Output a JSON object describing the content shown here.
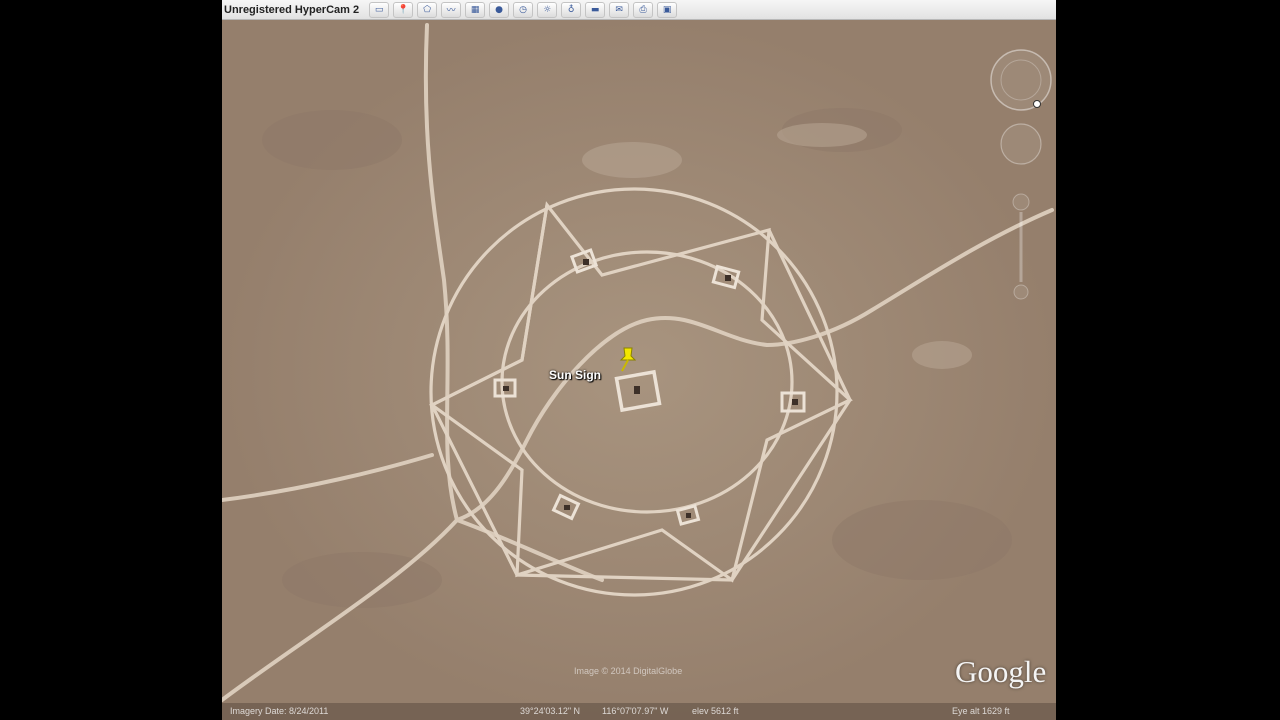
{
  "window": {
    "watermark": "Unregistered HyperCam 2"
  },
  "toolbar": {
    "buttons": [
      {
        "icon": "hide-sidebar-icon"
      },
      {
        "icon": "placemark-icon"
      },
      {
        "icon": "polygon-icon"
      },
      {
        "icon": "path-icon"
      },
      {
        "icon": "overlay-icon"
      },
      {
        "icon": "record-tour-icon"
      },
      {
        "icon": "historical-imagery-icon"
      },
      {
        "icon": "sun-icon"
      },
      {
        "icon": "planets-icon"
      },
      {
        "icon": "ruler-icon"
      },
      {
        "icon": "email-icon"
      },
      {
        "icon": "print-icon"
      },
      {
        "icon": "view-in-maps-icon"
      }
    ]
  },
  "map": {
    "placemark": {
      "label": "Sun Sign",
      "color": "#f2e600"
    }
  },
  "branding": {
    "logo": "Google",
    "copyright": "Image © 2014 DigitalGlobe"
  },
  "statusbar": {
    "imagery_date": "Imagery Date: 8/24/2011",
    "lat": "39°24'03.12\" N",
    "lon": "116°07'07.97\" W",
    "elev": "elev 5612 ft",
    "eye_alt": "Eye alt 1629 ft"
  },
  "colors": {
    "ground": "#9a8674",
    "track": "#d7c7b6",
    "window_black": "#000000"
  }
}
